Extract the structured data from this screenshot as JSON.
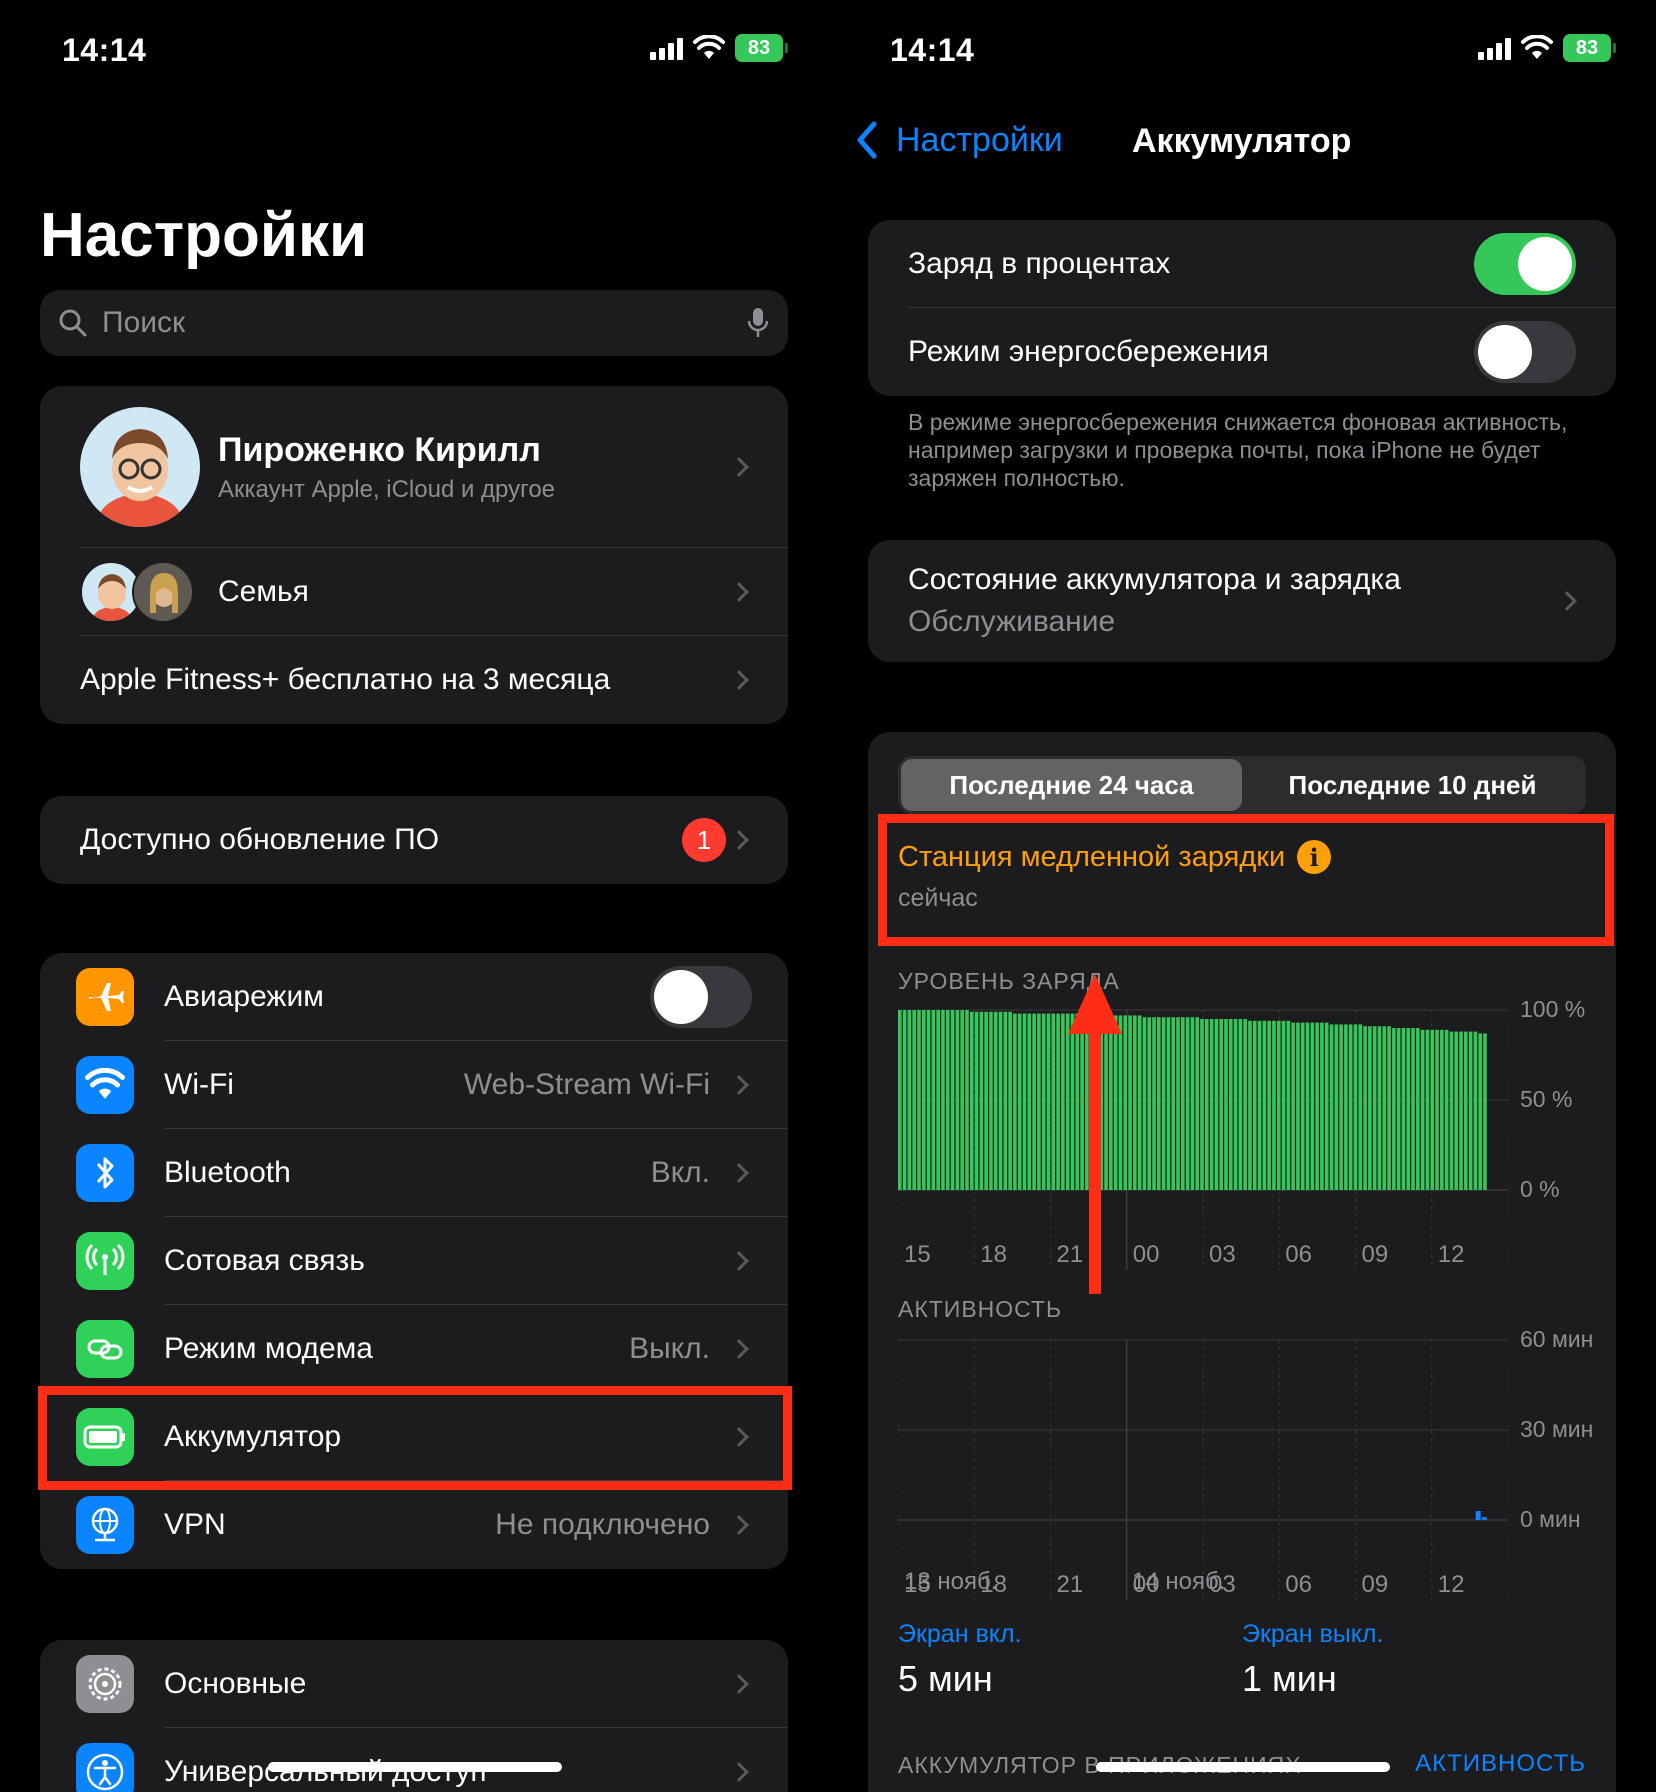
{
  "left": {
    "status": {
      "time": "14:14",
      "battery": "83"
    },
    "title": "Настройки",
    "search": {
      "placeholder": "Поиск"
    },
    "account": {
      "name": "Пироженко Кирилл",
      "subtitle": "Аккаунт Apple, iCloud и другое"
    },
    "family": {
      "label": "Семья"
    },
    "fitness": {
      "label": "Apple Fitness+ бесплатно на 3 месяца"
    },
    "update": {
      "label": "Доступно обновление ПО",
      "badge": "1"
    },
    "network": [
      {
        "label": "Авиарежим",
        "value": "",
        "icon": "airplane-icon",
        "color": "#ff9500"
      },
      {
        "label": "Wi-Fi",
        "value": "Web-Stream Wi-Fi",
        "icon": "wifi-icon",
        "color": "#0a84ff"
      },
      {
        "label": "Bluetooth",
        "value": "Вкл.",
        "icon": "bluetooth-icon",
        "color": "#0a84ff"
      },
      {
        "label": "Сотовая связь",
        "value": "",
        "icon": "antenna-icon",
        "color": "#30d158"
      },
      {
        "label": "Режим модема",
        "value": "Выкл.",
        "icon": "chain-link-icon",
        "color": "#30d158"
      },
      {
        "label": "Аккумулятор",
        "value": "",
        "icon": "battery-icon",
        "color": "#30d158"
      },
      {
        "label": "VPN",
        "value": "Не подключено",
        "icon": "globe-network-icon",
        "color": "#0a84ff"
      }
    ],
    "general": [
      {
        "label": "Основные",
        "icon": "gear-icon",
        "color": "#8e8e93"
      },
      {
        "label": "Универсальный доступ",
        "icon": "accessibility-icon",
        "color": "#0a84ff"
      }
    ],
    "airplane_on": false
  },
  "right": {
    "status": {
      "time": "14:14",
      "battery": "83"
    },
    "nav": {
      "back": "Настройки",
      "title": "Аккумулятор"
    },
    "percent": {
      "label": "Заряд в процентах",
      "on": true
    },
    "lowpower": {
      "label": "Режим энергосбережения",
      "on": false
    },
    "lowpower_footer": "В режиме энергосбережения снижается фоновая активность, например загрузки и проверка почты, пока iPhone не будет заряжен полностью.",
    "health": {
      "title": "Состояние аккумулятора и зарядка",
      "subtitle": "Обслуживание"
    },
    "segments": [
      "Последние 24 часа",
      "Последние 10 дней"
    ],
    "segment_active": 0,
    "slow_charge": {
      "title": "Станция медленной зарядки",
      "time": "сейчас"
    },
    "level_section": "УРОВЕНЬ ЗАРЯДА",
    "activity_section": "АКТИВНОСТЬ",
    "date_labels": [
      "13 нояб.",
      "14 нояб."
    ],
    "screen_on": {
      "label": "Экран вкл.",
      "value": "5 мин"
    },
    "screen_off": {
      "label": "Экран выкл.",
      "value": "1 мин"
    },
    "apps_section": "АККУМУЛЯТОР В ПРИЛОЖЕНИЯХ",
    "apps_toggle": "АКТИВНОСТЬ"
  },
  "chart_data": [
    {
      "type": "bar",
      "title": "УРОВЕНЬ ЗАРЯДА",
      "x_tick_labels": [
        "15",
        "18",
        "21",
        "00",
        "03",
        "06",
        "09",
        "12"
      ],
      "y_tick_labels": [
        "100 %",
        "50 %",
        "0 %"
      ],
      "ylim": [
        0,
        100
      ],
      "color": "#35c759",
      "values": [
        100,
        100,
        100,
        100,
        100,
        100,
        100,
        100,
        100,
        100,
        100,
        100,
        100,
        100,
        100,
        99,
        99,
        99,
        99,
        99,
        99,
        99,
        99,
        99,
        98,
        98,
        98,
        98,
        98,
        98,
        98,
        98,
        98,
        98,
        98,
        98,
        98,
        98,
        98,
        97,
        97,
        97,
        97,
        97,
        97,
        97,
        97,
        97,
        97,
        97,
        97,
        96,
        96,
        96,
        96,
        96,
        96,
        96,
        96,
        96,
        96,
        96,
        96,
        95,
        95,
        95,
        95,
        95,
        95,
        95,
        95,
        95,
        95,
        94,
        94,
        94,
        94,
        94,
        94,
        94,
        94,
        94,
        93,
        93,
        93,
        93,
        93,
        93,
        93,
        93,
        92,
        92,
        92,
        92,
        92,
        92,
        92,
        91,
        91,
        91,
        91,
        91,
        91,
        90,
        90,
        90,
        90,
        90,
        90,
        89,
        89,
        89,
        89,
        89,
        89,
        88,
        88,
        88,
        88,
        88,
        88,
        87,
        87
      ]
    },
    {
      "type": "bar",
      "title": "АКТИВНОСТЬ",
      "x_tick_labels": [
        "15",
        "18",
        "21",
        "00",
        "03",
        "06",
        "09",
        "12"
      ],
      "y_tick_labels": [
        "60 мин",
        "30 мин",
        "0 мин"
      ],
      "ylim": [
        0,
        60
      ],
      "color": "#0a84ff",
      "values": [
        0,
        0,
        0,
        0,
        0,
        0,
        0,
        0,
        0,
        0,
        0,
        0,
        0,
        0,
        0,
        0,
        0,
        0,
        0,
        0,
        0,
        0,
        0,
        0,
        0,
        0,
        0,
        0,
        0,
        0,
        0,
        0,
        0,
        0,
        0,
        0,
        0,
        0,
        0,
        0,
        0,
        0,
        0,
        0,
        0,
        0,
        0,
        0,
        0,
        0,
        0,
        0,
        0,
        0,
        0,
        0,
        0,
        0,
        0,
        0,
        0,
        0,
        0,
        0,
        0,
        0,
        0,
        0,
        0,
        0,
        0,
        0,
        0,
        0,
        0,
        0,
        0,
        0,
        0,
        0,
        0,
        0,
        0,
        0,
        0,
        0,
        0,
        0,
        0,
        0,
        0,
        0,
        0,
        0,
        3,
        1
      ]
    }
  ]
}
